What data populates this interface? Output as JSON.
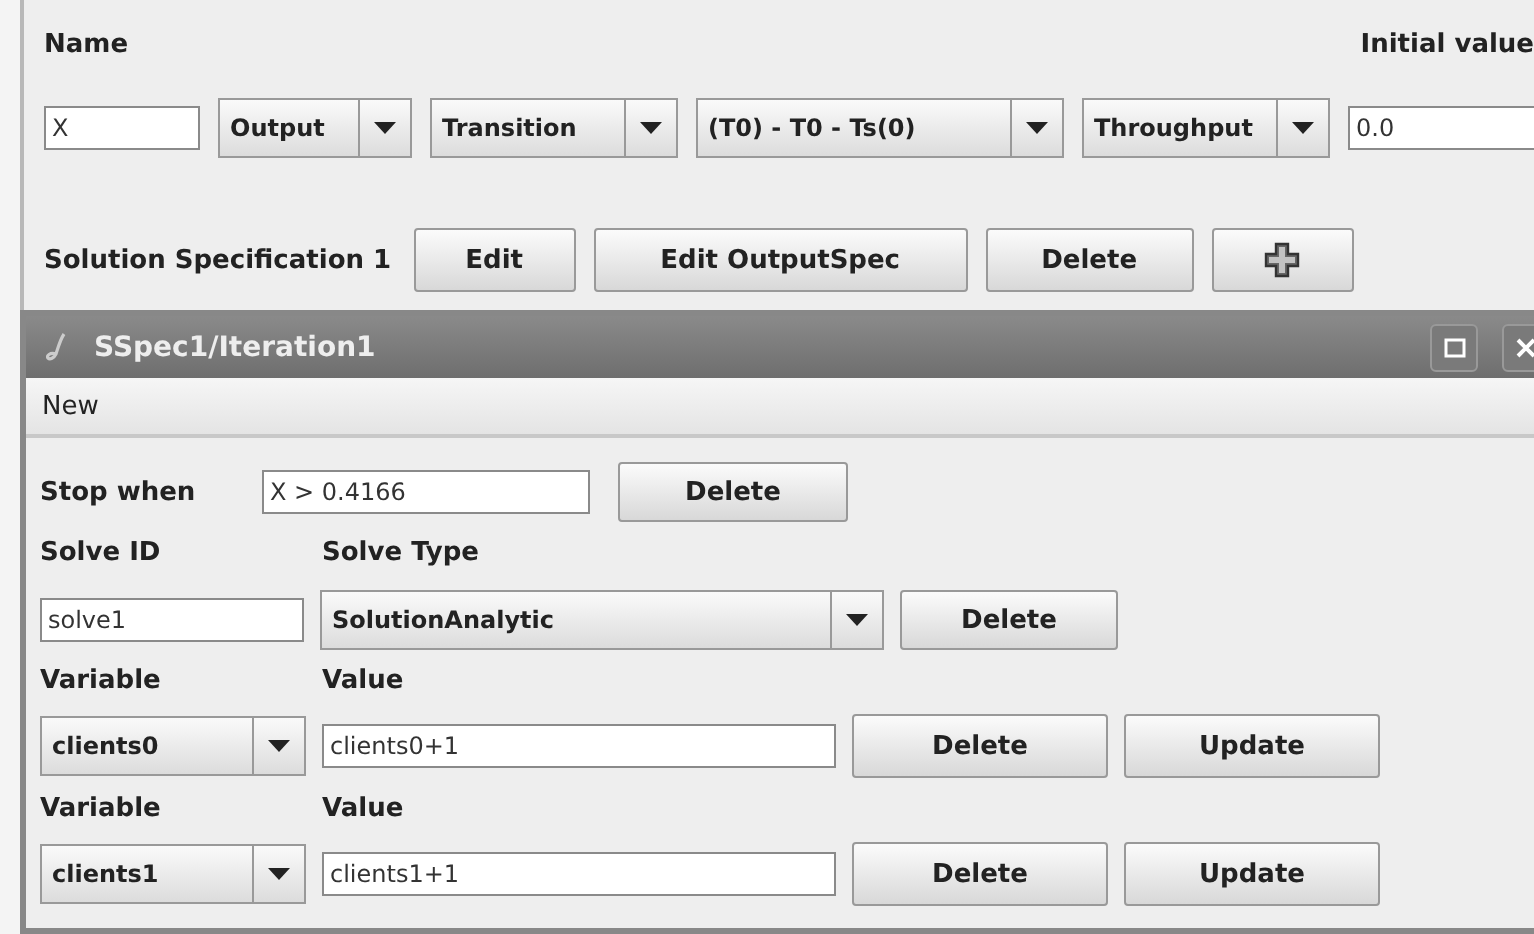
{
  "top": {
    "name_label": "Name",
    "initial_value_label": "Initial value",
    "name_value": "X",
    "combos": [
      {
        "value": "Output"
      },
      {
        "value": "Transition"
      },
      {
        "value": "(T0) - T0 - Ts(0)"
      },
      {
        "value": "Throughput"
      }
    ],
    "initial_value": "0.0",
    "solution_label": "Solution Specification 1",
    "buttons": [
      "Edit",
      "Edit OutputSpec",
      "Delete"
    ]
  },
  "frame": {
    "title": "SSpec1/Iteration1",
    "menu": [
      "New"
    ],
    "stop_label": "Stop when",
    "stop_value": "X > 0.4166",
    "stop_button": "Delete",
    "solve_id_label": "Solve ID",
    "solve_type_label": "Solve Type",
    "solve_id": "solve1",
    "solve_type": "SolutionAnalytic",
    "solve_button": "Delete",
    "assignments": [
      {
        "variable_label": "Variable",
        "value_label": "Value",
        "variable": "clients0",
        "value": "clients0+1",
        "buttons": [
          "Delete",
          "Update"
        ]
      },
      {
        "variable_label": "Variable",
        "value_label": "Value",
        "variable": "clients1",
        "value": "clients1+1",
        "buttons": [
          "Delete",
          "Update"
        ]
      }
    ]
  }
}
